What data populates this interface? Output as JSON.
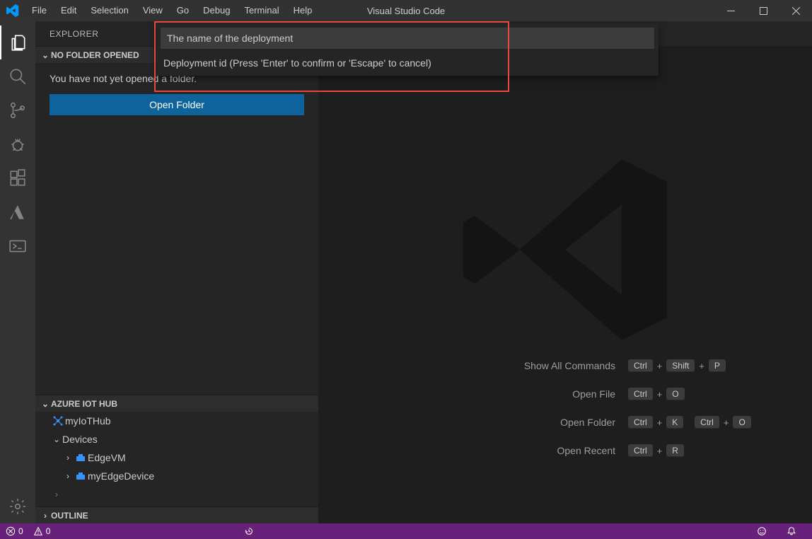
{
  "titlebar": {
    "app_title": "Visual Studio Code",
    "menu": [
      "File",
      "Edit",
      "Selection",
      "View",
      "Go",
      "Debug",
      "Terminal",
      "Help"
    ]
  },
  "activitybar": {
    "items": [
      {
        "name": "explorer-icon"
      },
      {
        "name": "search-icon"
      },
      {
        "name": "source-control-icon"
      },
      {
        "name": "debug-icon"
      },
      {
        "name": "extensions-icon"
      },
      {
        "name": "azure-icon"
      },
      {
        "name": "powershell-icon"
      }
    ],
    "settings_name": "gear-icon"
  },
  "sidebar": {
    "title": "EXPLORER",
    "no_folder_header": "NO FOLDER OPENED",
    "no_folder_message": "You have not yet opened a folder.",
    "open_folder_label": "Open Folder",
    "azure_header": "AZURE IOT HUB",
    "outline_header": "OUTLINE",
    "tree": {
      "hub_name": "myIoTHub",
      "devices_label": "Devices",
      "device1": "EdgeVM",
      "device2": "myEdgeDevice"
    }
  },
  "watermark": {
    "shortcuts": [
      {
        "label": "Show All Commands",
        "keys": [
          "Ctrl",
          "Shift",
          "P"
        ]
      },
      {
        "label": "Open File",
        "keys": [
          "Ctrl",
          "O"
        ]
      },
      {
        "label": "Open Folder",
        "keys": [
          "Ctrl",
          "K",
          "Ctrl",
          "O"
        ]
      },
      {
        "label": "Open Recent",
        "keys": [
          "Ctrl",
          "R"
        ]
      }
    ]
  },
  "command_input": {
    "value": "The name of the deployment",
    "hint": "Deployment id (Press 'Enter' to confirm or 'Escape' to cancel)"
  },
  "statusbar": {
    "errors": "0",
    "warnings": "0"
  }
}
